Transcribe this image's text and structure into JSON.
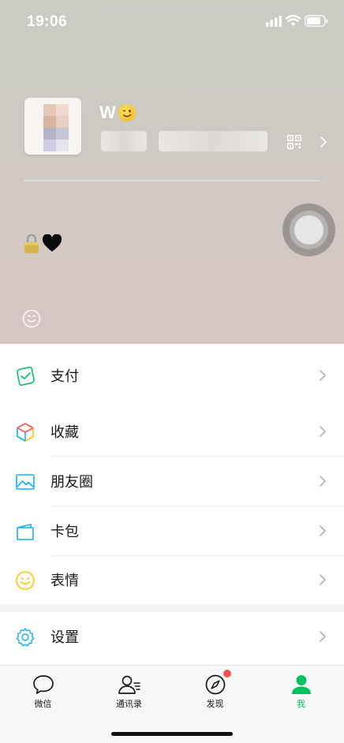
{
  "status_bar": {
    "time": "19:06"
  },
  "profile": {
    "nickname": "W"
  },
  "menu": {
    "pay": {
      "label": "支付"
    },
    "favorites": {
      "label": "收藏"
    },
    "moments": {
      "label": "朋友圈"
    },
    "cards": {
      "label": "卡包"
    },
    "stickers": {
      "label": "表情"
    },
    "settings": {
      "label": "设置"
    }
  },
  "tabs": [
    {
      "label": "微信",
      "icon": "chat-bubble-icon"
    },
    {
      "label": "通讯录",
      "icon": "contacts-icon"
    },
    {
      "label": "发现",
      "icon": "compass-icon"
    },
    {
      "label": "我",
      "icon": "person-icon"
    }
  ],
  "colors": {
    "accent": "#07c160",
    "badge": "#fa5151"
  }
}
